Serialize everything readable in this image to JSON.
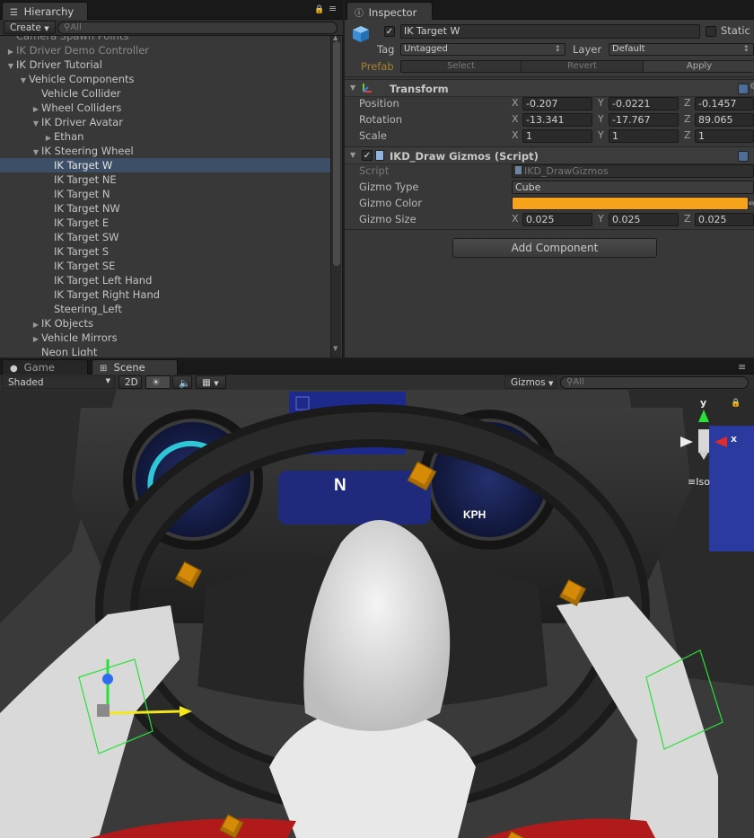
{
  "hierarchy": {
    "tab_label": "Hierarchy",
    "create_label": "Create",
    "search_placeholder": "All",
    "rows": [
      {
        "label": "Camera Spawn Points",
        "depth": 1,
        "arrow": "none",
        "style": "dim"
      },
      {
        "label": "IK Driver Demo Controller",
        "depth": 1,
        "arrow": "right",
        "style": "dim"
      },
      {
        "label": "IK Driver Tutorial",
        "depth": 1,
        "arrow": "down",
        "style": "normal"
      },
      {
        "label": "Vehicle Components",
        "depth": 2,
        "arrow": "down",
        "style": "normal"
      },
      {
        "label": "Vehicle Collider",
        "depth": 3,
        "arrow": "none",
        "style": "normal"
      },
      {
        "label": "Wheel Colliders",
        "depth": 3,
        "arrow": "right",
        "style": "normal"
      },
      {
        "label": "IK Driver Avatar",
        "depth": 3,
        "arrow": "down",
        "style": "normal"
      },
      {
        "label": "Ethan",
        "depth": 4,
        "arrow": "right",
        "style": "normal"
      },
      {
        "label": "IK Steering Wheel",
        "depth": 3,
        "arrow": "down",
        "style": "normal"
      },
      {
        "label": "IK Target W",
        "depth": 4,
        "arrow": "none",
        "style": "selected"
      },
      {
        "label": "IK Target NE",
        "depth": 4,
        "arrow": "none",
        "style": "normal"
      },
      {
        "label": "IK Target N",
        "depth": 4,
        "arrow": "none",
        "style": "normal"
      },
      {
        "label": "IK Target NW",
        "depth": 4,
        "arrow": "none",
        "style": "normal"
      },
      {
        "label": "IK Target E",
        "depth": 4,
        "arrow": "none",
        "style": "normal"
      },
      {
        "label": "IK Target SW",
        "depth": 4,
        "arrow": "none",
        "style": "normal"
      },
      {
        "label": "IK Target S",
        "depth": 4,
        "arrow": "none",
        "style": "normal"
      },
      {
        "label": "IK Target SE",
        "depth": 4,
        "arrow": "none",
        "style": "normal"
      },
      {
        "label": "IK Target Left Hand",
        "depth": 4,
        "arrow": "none",
        "style": "normal"
      },
      {
        "label": "IK Target Right Hand",
        "depth": 4,
        "arrow": "none",
        "style": "normal"
      },
      {
        "label": "Steering_Left",
        "depth": 4,
        "arrow": "none",
        "style": "normal"
      },
      {
        "label": "IK Objects",
        "depth": 3,
        "arrow": "right",
        "style": "normal"
      },
      {
        "label": "Vehicle Mirrors",
        "depth": 3,
        "arrow": "right",
        "style": "normal"
      },
      {
        "label": "Neon Light",
        "depth": 3,
        "arrow": "none",
        "style": "normal"
      }
    ]
  },
  "inspector": {
    "tab_label": "Inspector",
    "object_name": "IK Target W",
    "active_checked": true,
    "static_label": "Static",
    "tag_label": "Tag",
    "tag_value": "Untagged",
    "layer_label": "Layer",
    "layer_value": "Default",
    "prefab_label": "Prefab",
    "prefab_select": "Select",
    "prefab_revert": "Revert",
    "prefab_apply": "Apply",
    "transform": {
      "title": "Transform",
      "position_label": "Position",
      "rotation_label": "Rotation",
      "scale_label": "Scale",
      "position": {
        "x": "-0.207",
        "y": "-0.0221",
        "z": "-0.1457"
      },
      "rotation": {
        "x": "-13.341",
        "y": "-17.767",
        "z": "89.065"
      },
      "scale": {
        "x": "1",
        "y": "1",
        "z": "1"
      }
    },
    "script_component": {
      "title": "IKD_Draw Gizmos (Script)",
      "script_label": "Script",
      "script_value": "IKD_DrawGizmos",
      "gizmo_type_label": "Gizmo Type",
      "gizmo_type_value": "Cube",
      "gizmo_color_label": "Gizmo Color",
      "gizmo_color": "#f7a21b",
      "gizmo_size_label": "Gizmo Size",
      "gizmo_size": {
        "x": "0.025",
        "y": "0.025",
        "z": "0.025"
      }
    },
    "axis_x": "X",
    "axis_y": "Y",
    "axis_z": "Z",
    "add_component_label": "Add Component"
  },
  "scene": {
    "game_tab_label": "Game",
    "scene_tab_label": "Scene",
    "shading_mode": "Shaded",
    "mode_2d": "2D",
    "gizmos_label": "Gizmos",
    "search_placeholder": "All",
    "gizmo_y": "y",
    "gizmo_x": "x",
    "projection_label": "Iso",
    "dash_letter_n": "N",
    "dash_text_kph": "KPH"
  },
  "colors": {
    "selection": "#3d4f66",
    "target_cube": "#d58a08",
    "gizmo_green": "#29e03a",
    "gizmo_blue": "#2d6bf0",
    "gizmo_yellow": "#f3e61b",
    "gizmo_red": "#e02b2b"
  }
}
